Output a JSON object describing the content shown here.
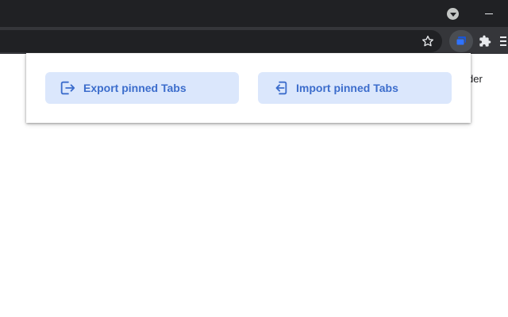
{
  "browser": {
    "titlebar_color": "#202124",
    "toolbar_color": "#35363a",
    "icons": {
      "profile": "profile-dropdown-icon",
      "minimize": "minimize-icon",
      "bookmark": "star-icon",
      "extension_active": "pinned-tabs-extension-icon",
      "extensions": "puzzle-icon",
      "menu": "menu-icon"
    }
  },
  "page": {
    "partial_text": "der"
  },
  "popup": {
    "export_button": {
      "label": "Export pinned Tabs",
      "icon": "export-icon"
    },
    "import_button": {
      "label": "Import pinned Tabs",
      "icon": "import-icon"
    },
    "button_bg": "#dbe7fc",
    "button_text_color": "#3c6dcc"
  }
}
